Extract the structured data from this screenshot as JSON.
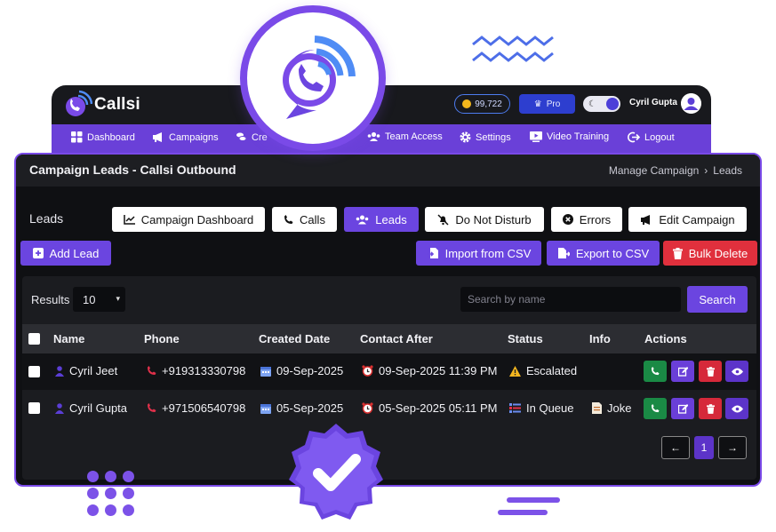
{
  "app": {
    "name": "Callsi",
    "coins": "99,722",
    "plan": "Pro",
    "user_name": "Cyril Gupta"
  },
  "nav": [
    {
      "label": "Dashboard",
      "icon": "dashboard-icon"
    },
    {
      "label": "Campaigns",
      "icon": "megaphone-icon"
    },
    {
      "label": "Cre",
      "icon": "coins-icon"
    },
    {
      "label": "Team Access",
      "icon": "team-icon"
    },
    {
      "label": "Settings",
      "icon": "gear-icon"
    },
    {
      "label": "Video Training",
      "icon": "video-icon"
    },
    {
      "label": "Logout",
      "icon": "logout-icon"
    }
  ],
  "page": {
    "title": "Campaign Leads - Callsi Outbound",
    "breadcrumb": [
      "Manage Campaign",
      "Leads"
    ],
    "section_label": "Leads"
  },
  "tabs": [
    {
      "label": "Campaign Dashboard",
      "icon": "chart-icon",
      "active": false
    },
    {
      "label": "Calls",
      "icon": "phone-icon",
      "active": false
    },
    {
      "label": "Leads",
      "icon": "users-icon",
      "active": true
    },
    {
      "label": "Do Not Disturb",
      "icon": "bell-slash-icon",
      "active": false
    },
    {
      "label": "Errors",
      "icon": "error-icon",
      "active": false
    },
    {
      "label": "Edit Campaign",
      "icon": "megaphone-icon",
      "active": false
    }
  ],
  "actions": {
    "add_lead": "Add Lead",
    "import_csv": "Import from CSV",
    "export_csv": "Export to CSV",
    "bulk_delete": "Bulk Delete"
  },
  "filters": {
    "results_label": "Results",
    "results_value": "10",
    "search_placeholder": "Search by name",
    "search_button": "Search"
  },
  "table": {
    "columns": [
      "Name",
      "Phone",
      "Created Date",
      "Contact After",
      "Status",
      "Info",
      "Actions"
    ],
    "rows": [
      {
        "name": "Cyril Jeet",
        "phone": "+919313330798",
        "created": "09-Sep-2025",
        "contact_after": "09-Sep-2025 11:39 PM",
        "status": "Escalated",
        "status_icon": "warning-icon",
        "info": ""
      },
      {
        "name": "Cyril Gupta",
        "phone": "+971506540798",
        "created": "05-Sep-2025",
        "contact_after": "05-Sep-2025 05:11 PM",
        "status": "In Queue",
        "status_icon": "queue-icon",
        "info": "Joke"
      }
    ]
  },
  "pagination": {
    "prev": "←",
    "current": "1",
    "next": "→"
  },
  "colors": {
    "accent": "#6b45e0",
    "danger": "#e0303d",
    "success": "#1a8a45",
    "card_bg": "#0f1013"
  }
}
